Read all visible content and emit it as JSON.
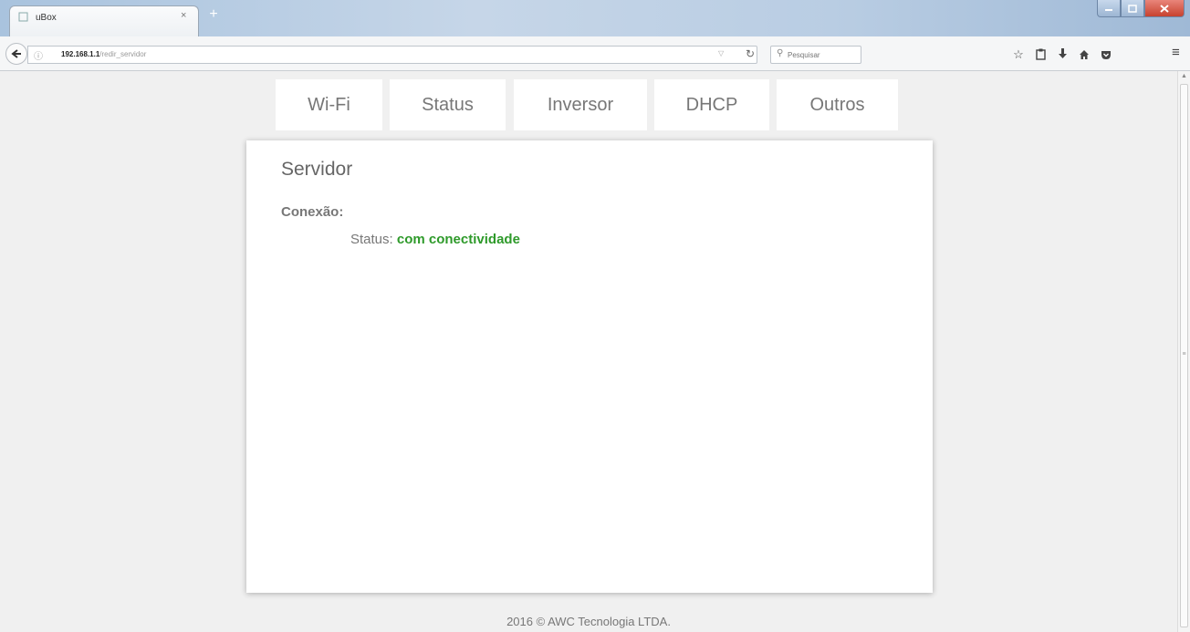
{
  "browser": {
    "tab_title": "uBox",
    "tab_close": "×",
    "new_tab": "+",
    "url_host": "192.168.1.1",
    "url_path": "/redir_servidor",
    "search_placeholder": "Pesquisar",
    "icons": [
      "bookmark-star-icon",
      "reading-list-icon",
      "download-icon",
      "home-icon",
      "pocket-icon",
      "menu-icon"
    ]
  },
  "nav": {
    "tabs": [
      {
        "label": "Wi-Fi"
      },
      {
        "label": "Status"
      },
      {
        "label": "Inversor"
      },
      {
        "label": "DHCP"
      },
      {
        "label": "Outros"
      }
    ]
  },
  "card": {
    "title": "Servidor",
    "section": "Conexão:",
    "status_label": "Status:",
    "status_value": "com conectividade"
  },
  "footer": "2016 © AWC Tecnologia LTDA.",
  "colors": {
    "status_ok": "#2e9a2a",
    "page_bg": "#f0f0f0",
    "card_bg": "#ffffff"
  }
}
